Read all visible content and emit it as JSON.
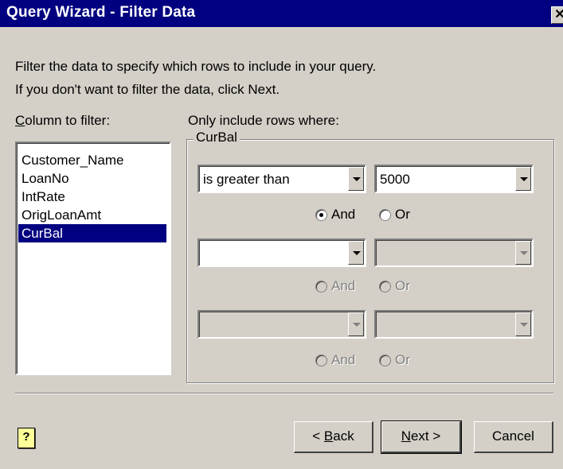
{
  "window": {
    "title": "Query Wizard - Filter Data",
    "close_glyph": "✕"
  },
  "intro": {
    "line1": "Filter the data to specify which rows to include in your query.",
    "line2": "If you don't want to filter the data, click Next."
  },
  "column_list": {
    "label_accel": "C",
    "label_rest": "olumn to filter:",
    "items": [
      "Customer_Name",
      "LoanNo",
      "IntRate",
      "OrigLoanAmt",
      "CurBal"
    ],
    "selected": "CurBal"
  },
  "criteria": {
    "label": "Only include rows where:",
    "group_title": "CurBal",
    "rows": [
      {
        "operator": "is greater than",
        "value": "5000",
        "enabled": true,
        "and_label": "And",
        "or_label": "Or",
        "and_checked": true,
        "connectors_enabled": true
      },
      {
        "operator": "",
        "value": "",
        "enabled": true,
        "value_enabled": false,
        "and_label": "And",
        "or_label": "Or",
        "and_checked": false,
        "connectors_enabled": false
      },
      {
        "operator": "",
        "value": "",
        "enabled": false,
        "and_label": "And",
        "or_label": "Or",
        "and_checked": false,
        "connectors_enabled": false
      }
    ]
  },
  "buttons": {
    "help_glyph": "?",
    "back_prefix": "< ",
    "back_accel": "B",
    "back_rest": "ack",
    "next_accel": "N",
    "next_rest": "ext >",
    "cancel": "Cancel"
  }
}
